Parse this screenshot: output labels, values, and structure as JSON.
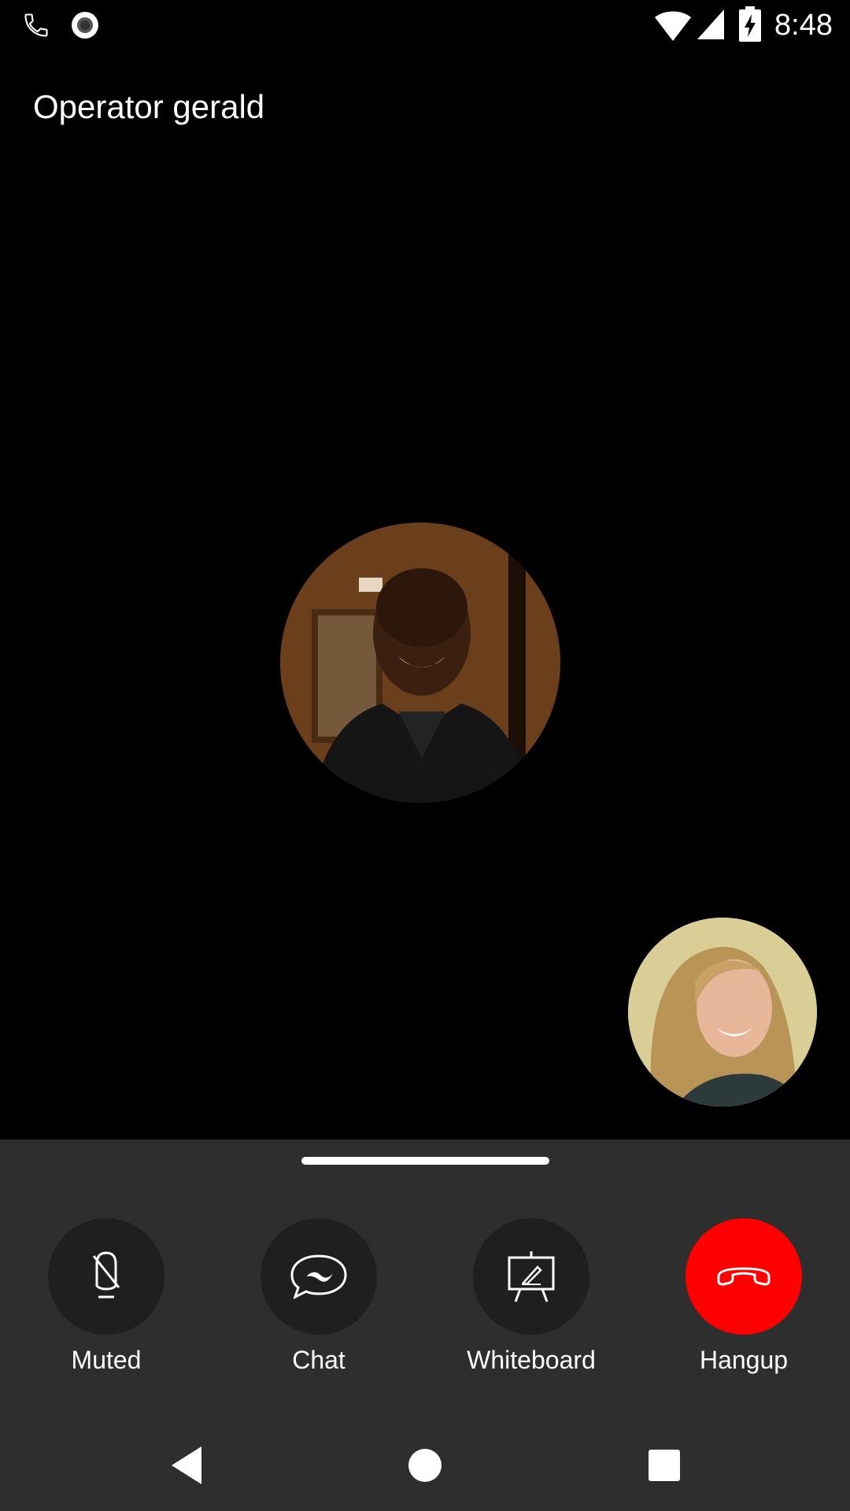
{
  "status_bar": {
    "time": "8:48",
    "icons": [
      "phone-icon",
      "record-icon",
      "wifi-icon",
      "signal-icon",
      "battery-charging-icon"
    ]
  },
  "call": {
    "caller_name": "Operator gerald"
  },
  "controls": {
    "mute": {
      "label": "Muted",
      "icon": "mic-off-icon"
    },
    "chat": {
      "label": "Chat",
      "icon": "chat-bubble-icon"
    },
    "whiteboard": {
      "label": "Whiteboard",
      "icon": "whiteboard-icon"
    },
    "hangup": {
      "label": "Hangup",
      "icon": "hangup-phone-icon"
    }
  },
  "nav_bar": {
    "icons": [
      "back-icon",
      "home-icon",
      "recents-icon"
    ]
  },
  "colors": {
    "background": "#000000",
    "panel": "#2e2e2e",
    "control_circle": "#1f1f1f",
    "hangup_red": "#ff0000",
    "text": "#ffffff"
  }
}
